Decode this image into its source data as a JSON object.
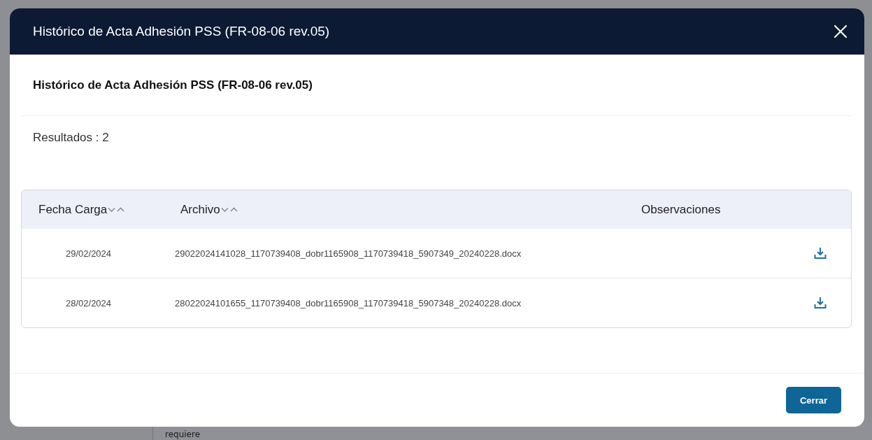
{
  "background": {
    "text": "requiere"
  },
  "modal": {
    "title": "Histórico de Acta Adhesión PSS (FR-08-06 rev.05)",
    "subtitle": "Histórico de Acta Adhesión PSS (FR-08-06 rev.05)",
    "results": "Resultados : 2",
    "table": {
      "columns": [
        {
          "label": "Fecha Carga",
          "sortable": true
        },
        {
          "label": "Archivo",
          "sortable": true
        },
        {
          "label": "Observaciones",
          "sortable": false
        }
      ],
      "rows": [
        {
          "date": "29/02/2024",
          "file": "29022024141028_1170739408_dobr1165908_1170739418_5907349_20240228.docx"
        },
        {
          "date": "28/02/2024",
          "file": "28022024101655_1170739408_dobr1165908_1170739418_5907348_20240228.docx"
        }
      ]
    },
    "buttons": [
      "Cerrar"
    ]
  }
}
